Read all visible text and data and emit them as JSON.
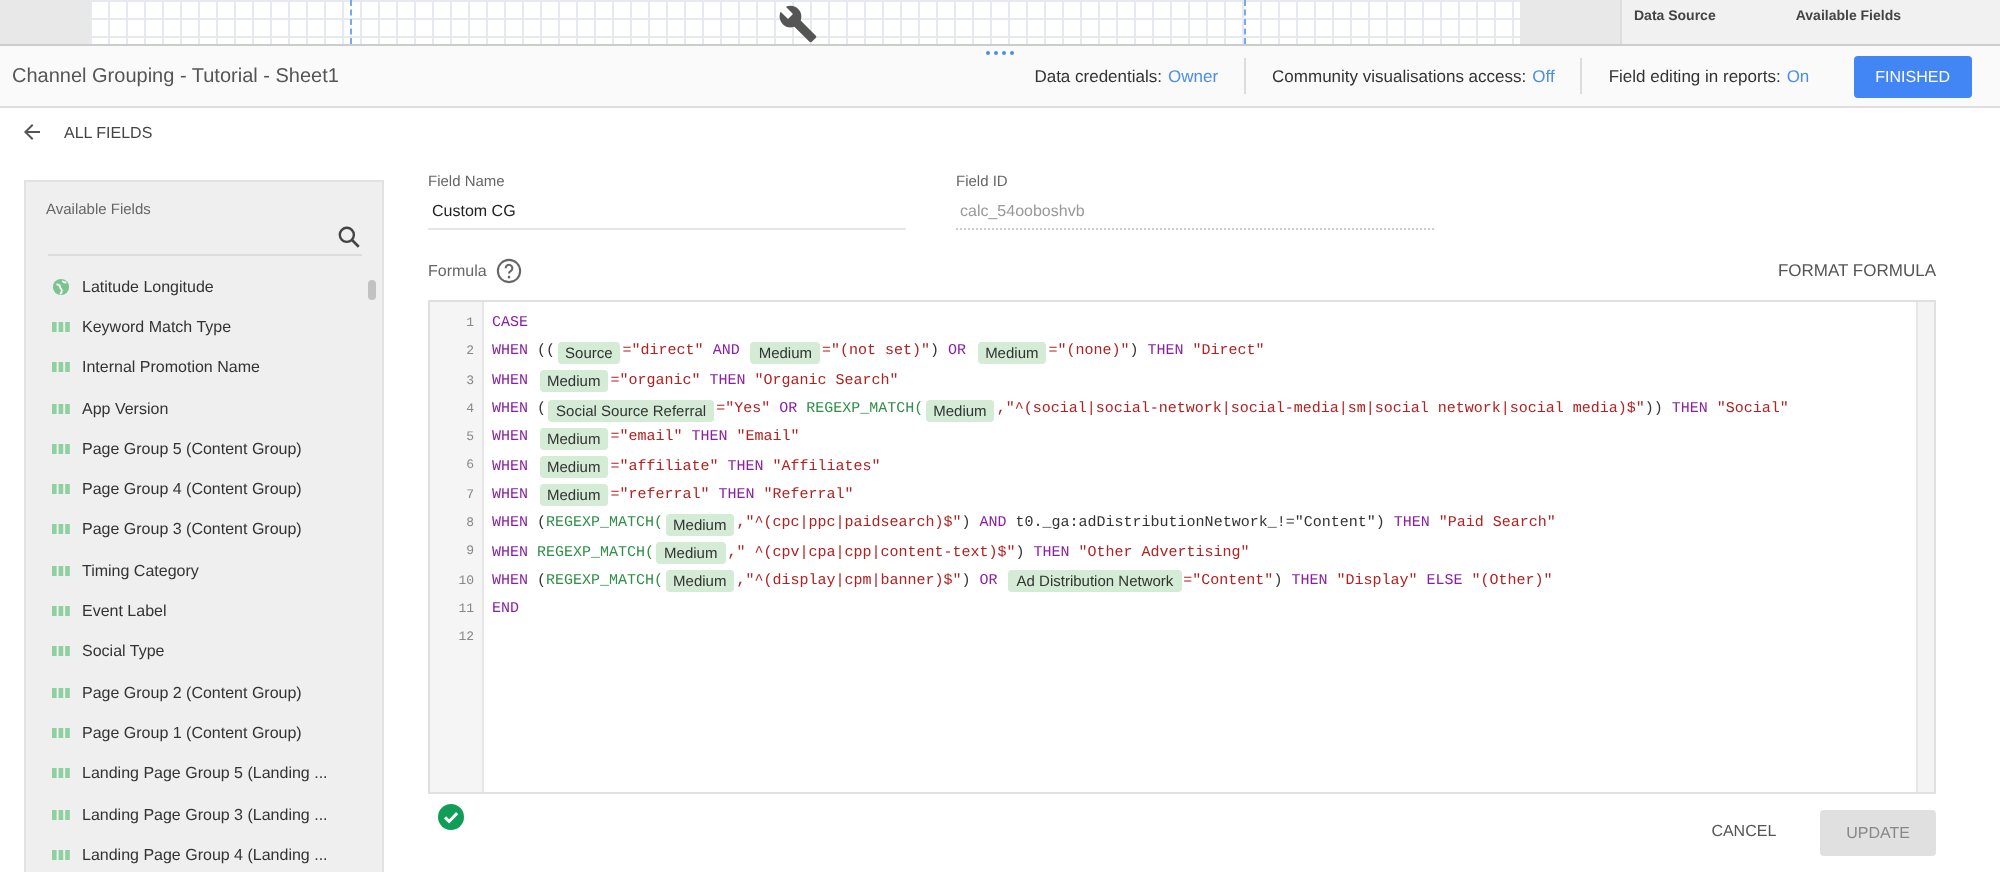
{
  "top_panel": {
    "labels": [
      "Data Source",
      "Available Fields"
    ]
  },
  "header": {
    "title": "Channel Grouping - Tutorial - Sheet1",
    "settings": [
      {
        "label": "Data credentials:",
        "value": "Owner"
      },
      {
        "label": "Community visualisations access:",
        "value": "Off"
      },
      {
        "label": "Field editing in reports:",
        "value": "On"
      }
    ],
    "finish_button": "FINISHED"
  },
  "back_link": "ALL FIELDS",
  "fields_panel": {
    "title": "Available Fields",
    "items": [
      {
        "label": "Latitude Longitude",
        "kind": "geo"
      },
      {
        "label": "Keyword Match Type",
        "kind": "text"
      },
      {
        "label": "Internal Promotion Name",
        "kind": "text"
      },
      {
        "label": "App Version",
        "kind": "text"
      },
      {
        "label": "Page Group 5 (Content Group)",
        "kind": "text"
      },
      {
        "label": "Page Group 4 (Content Group)",
        "kind": "text"
      },
      {
        "label": "Page Group 3 (Content Group)",
        "kind": "text"
      },
      {
        "label": "Timing Category",
        "kind": "text"
      },
      {
        "label": "Event Label",
        "kind": "text"
      },
      {
        "label": "Social Type",
        "kind": "text"
      },
      {
        "label": "Page Group 2 (Content Group)",
        "kind": "text"
      },
      {
        "label": "Page Group 1 (Content Group)",
        "kind": "text"
      },
      {
        "label": "Landing Page Group 5 (Landing ...",
        "kind": "text"
      },
      {
        "label": "Landing Page Group 3 (Landing ...",
        "kind": "text"
      },
      {
        "label": "Landing Page Group 4 (Landing ...",
        "kind": "text"
      }
    ]
  },
  "editor": {
    "field_name": {
      "label": "Field Name",
      "value": "Custom CG"
    },
    "field_id": {
      "label": "Field ID",
      "value": "calc_54ooboshvb",
      "disabled": true
    },
    "formula_label": "Formula",
    "format_button": "FORMAT FORMULA",
    "lines": [
      {
        "number": "1",
        "tokens": [
          {
            "kind": "kw",
            "text": "CASE"
          }
        ]
      },
      {
        "number": "2",
        "tokens": [
          {
            "kind": "kw",
            "text": "WHEN"
          },
          {
            "kind": "p",
            "text": " (("
          },
          {
            "kind": "chip",
            "text": "Source"
          },
          {
            "kind": "str",
            "text": "=\"direct\""
          },
          {
            "kind": "kw",
            "text": " AND "
          },
          {
            "kind": "chip",
            "text": "Medium"
          },
          {
            "kind": "str",
            "text": "=\"(not set)\""
          },
          {
            "kind": "p",
            "text": ")"
          },
          {
            "kind": "kw",
            "text": " OR "
          },
          {
            "kind": "chip",
            "text": "Medium"
          },
          {
            "kind": "str",
            "text": "=\"(none)\""
          },
          {
            "kind": "p",
            "text": ")"
          },
          {
            "kind": "kw",
            "text": " THEN "
          },
          {
            "kind": "str",
            "text": "\"Direct\""
          }
        ]
      },
      {
        "number": "3",
        "tokens": [
          {
            "kind": "kw",
            "text": "WHEN "
          },
          {
            "kind": "chip",
            "text": "Medium"
          },
          {
            "kind": "str",
            "text": "=\"organic\""
          },
          {
            "kind": "kw",
            "text": " THEN "
          },
          {
            "kind": "str",
            "text": "\"Organic Search\""
          }
        ]
      },
      {
        "number": "4",
        "tokens": [
          {
            "kind": "kw",
            "text": "WHEN"
          },
          {
            "kind": "p",
            "text": " ("
          },
          {
            "kind": "chip",
            "text": "Social Source Referral"
          },
          {
            "kind": "str",
            "text": "=\"Yes\""
          },
          {
            "kind": "kw",
            "text": " OR "
          },
          {
            "kind": "fn",
            "text": "REGEXP_MATCH("
          },
          {
            "kind": "chip",
            "text": "Medium"
          },
          {
            "kind": "str",
            "text": ",\"^(social|social-network|social-media|sm|social network|social media)$\""
          },
          {
            "kind": "p",
            "text": "))"
          },
          {
            "kind": "kw",
            "text": " THEN "
          },
          {
            "kind": "str",
            "text": "\"Social\""
          }
        ]
      },
      {
        "number": "5",
        "tokens": [
          {
            "kind": "kw",
            "text": "WHEN "
          },
          {
            "kind": "chip",
            "text": "Medium"
          },
          {
            "kind": "str",
            "text": "=\"email\""
          },
          {
            "kind": "kw",
            "text": " THEN "
          },
          {
            "kind": "str",
            "text": "\"Email\""
          }
        ]
      },
      {
        "number": "6",
        "tokens": [
          {
            "kind": "kw",
            "text": "WHEN "
          },
          {
            "kind": "chip",
            "text": "Medium"
          },
          {
            "kind": "str",
            "text": "=\"affiliate\""
          },
          {
            "kind": "kw",
            "text": " THEN "
          },
          {
            "kind": "str",
            "text": "\"Affiliates\""
          }
        ]
      },
      {
        "number": "7",
        "tokens": [
          {
            "kind": "kw",
            "text": "WHEN "
          },
          {
            "kind": "chip",
            "text": "Medium"
          },
          {
            "kind": "str",
            "text": "=\"referral\""
          },
          {
            "kind": "kw",
            "text": " THEN "
          },
          {
            "kind": "str",
            "text": "\"Referral\""
          }
        ]
      },
      {
        "number": "8",
        "tokens": [
          {
            "kind": "kw",
            "text": "WHEN"
          },
          {
            "kind": "p",
            "text": " ("
          },
          {
            "kind": "fn",
            "text": "REGEXP_MATCH("
          },
          {
            "kind": "chip",
            "text": "Medium"
          },
          {
            "kind": "str",
            "text": ",\"^(cpc|ppc|paidsearch)$\""
          },
          {
            "kind": "p",
            "text": ")"
          },
          {
            "kind": "kw",
            "text": " AND "
          },
          {
            "kind": "p",
            "text": "t0._ga:adDistributionNetwork_!=\"Content\")"
          },
          {
            "kind": "kw",
            "text": " THEN "
          },
          {
            "kind": "str",
            "text": "\"Paid Search\""
          }
        ]
      },
      {
        "number": "9",
        "tokens": [
          {
            "kind": "kw",
            "text": "WHEN "
          },
          {
            "kind": "fn",
            "text": "REGEXP_MATCH("
          },
          {
            "kind": "chip",
            "text": "Medium"
          },
          {
            "kind": "str",
            "text": ",\" ^(cpv|cpa|cpp|content-text)$\""
          },
          {
            "kind": "p",
            "text": ")"
          },
          {
            "kind": "kw",
            "text": " THEN "
          },
          {
            "kind": "str",
            "text": "\"Other Advertising\""
          }
        ]
      },
      {
        "number": "10",
        "tokens": [
          {
            "kind": "kw",
            "text": "WHEN"
          },
          {
            "kind": "p",
            "text": " ("
          },
          {
            "kind": "fn",
            "text": "REGEXP_MATCH("
          },
          {
            "kind": "chip",
            "text": "Medium"
          },
          {
            "kind": "str",
            "text": ",\"^(display|cpm|banner)$\""
          },
          {
            "kind": "p",
            "text": ")"
          },
          {
            "kind": "kw",
            "text": " OR "
          },
          {
            "kind": "chip",
            "text": "Ad Distribution Network"
          },
          {
            "kind": "str",
            "text": "=\"Content\""
          },
          {
            "kind": "p",
            "text": ")"
          },
          {
            "kind": "kw",
            "text": " THEN "
          },
          {
            "kind": "str",
            "text": "\"Display\""
          },
          {
            "kind": "kw",
            "text": " ELSE "
          },
          {
            "kind": "str",
            "text": "\"(Other)\""
          }
        ]
      },
      {
        "number": "11",
        "tokens": [
          {
            "kind": "kw",
            "text": "END"
          }
        ]
      },
      {
        "number": "12"
      }
    ],
    "valid": true,
    "cancel_button": "CANCEL",
    "update_button": {
      "label": "UPDATE",
      "disabled": true
    }
  }
}
